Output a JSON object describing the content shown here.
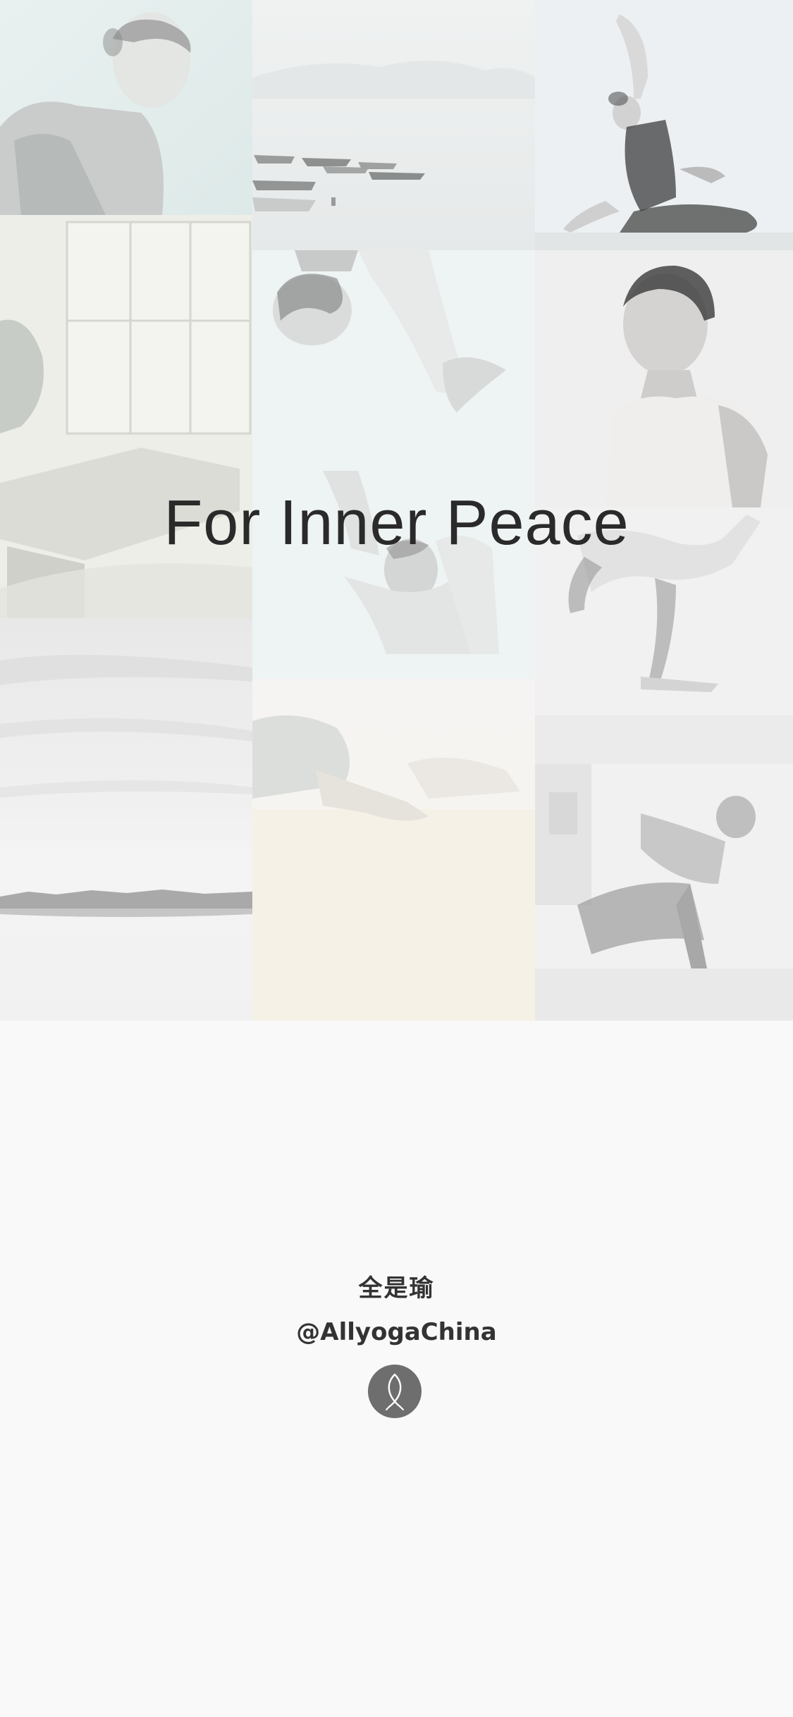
{
  "headline": "For Inner Peace",
  "brand": {
    "name_cn": "全是瑜",
    "handle": "@AllyogaChina"
  },
  "logo": {
    "icon": "fish-logo-icon"
  },
  "collage": {
    "tiles": [
      {
        "subject": "woman-smiling"
      },
      {
        "subject": "studio-window"
      },
      {
        "subject": "sea-horizon"
      },
      {
        "subject": "misty-boats"
      },
      {
        "subject": "man-upside-down"
      },
      {
        "subject": "man-arms-raised"
      },
      {
        "subject": "resting-pose"
      },
      {
        "subject": "woman-stretch"
      },
      {
        "subject": "man-profile"
      },
      {
        "subject": "backbend"
      },
      {
        "subject": "twist-pose"
      }
    ]
  },
  "colors": {
    "background": "#f9f9f9",
    "headline": "#2a2a2a",
    "brand_text": "#333333",
    "logo": "#6e6e6e"
  }
}
